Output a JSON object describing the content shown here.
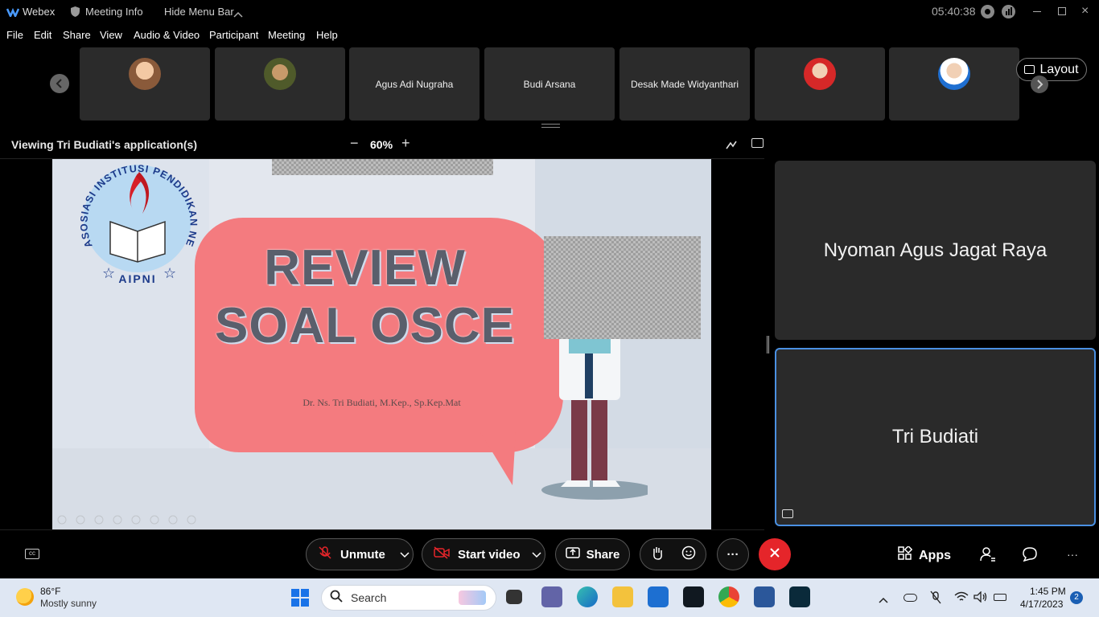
{
  "window": {
    "app_name": "Webex",
    "meeting_info": "Meeting Info",
    "hide_menu": "Hide Menu Bar",
    "clock": "05:40:38"
  },
  "menu": [
    "File",
    "Edit",
    "Share",
    "View",
    "Audio & Video",
    "Participant",
    "Meeting",
    "Help"
  ],
  "participants": [
    {
      "name": "",
      "avatar": true,
      "avatar_color": "#c98a55"
    },
    {
      "name": "",
      "avatar": true,
      "avatar_color": "#6b7a3a"
    },
    {
      "name": "Agus Adi Nugraha",
      "avatar": false
    },
    {
      "name": "Budi Arsana",
      "avatar": false
    },
    {
      "name": "Desak Made Widyanthari",
      "avatar": false
    },
    {
      "name": "",
      "avatar": true,
      "avatar_color": "#d62828"
    },
    {
      "name": "",
      "avatar": true,
      "avatar_color": "#1f6fd1"
    }
  ],
  "layout_label": "Layout",
  "viewing": {
    "label": "Viewing Tri Budiati's application(s)",
    "zoom": "60%",
    "zoom_minus": "−",
    "zoom_plus": "+"
  },
  "slide": {
    "logo_text": "ASOSIASI INSTITUSI PENDIDIKAN NERS INDONESIA",
    "logo_abbr": "AIPNI",
    "title_line1": "REVIEW",
    "title_line2": "SOAL OSCE",
    "author": "Dr. Ns. Tri Budiati, M.Kep., Sp.Kep.Mat"
  },
  "right_tiles": {
    "top_name": "Nyoman Agus Jagat Raya",
    "bottom_name": "Tri Budiati"
  },
  "controls": {
    "unmute": "Unmute",
    "start_video": "Start video",
    "share": "Share",
    "more": "···",
    "apps": "Apps"
  },
  "taskbar": {
    "temperature": "86°F",
    "weather": "Mostly sunny",
    "search_placeholder": "Search",
    "time": "1:45 PM",
    "date": "4/17/2023",
    "notif_count": "2"
  },
  "colors": {
    "accent_blue": "#4a90e2",
    "end_red": "#e5252a",
    "slide_bubble": "#f47b7f",
    "taskbar_bg": "#dfe7f3"
  }
}
